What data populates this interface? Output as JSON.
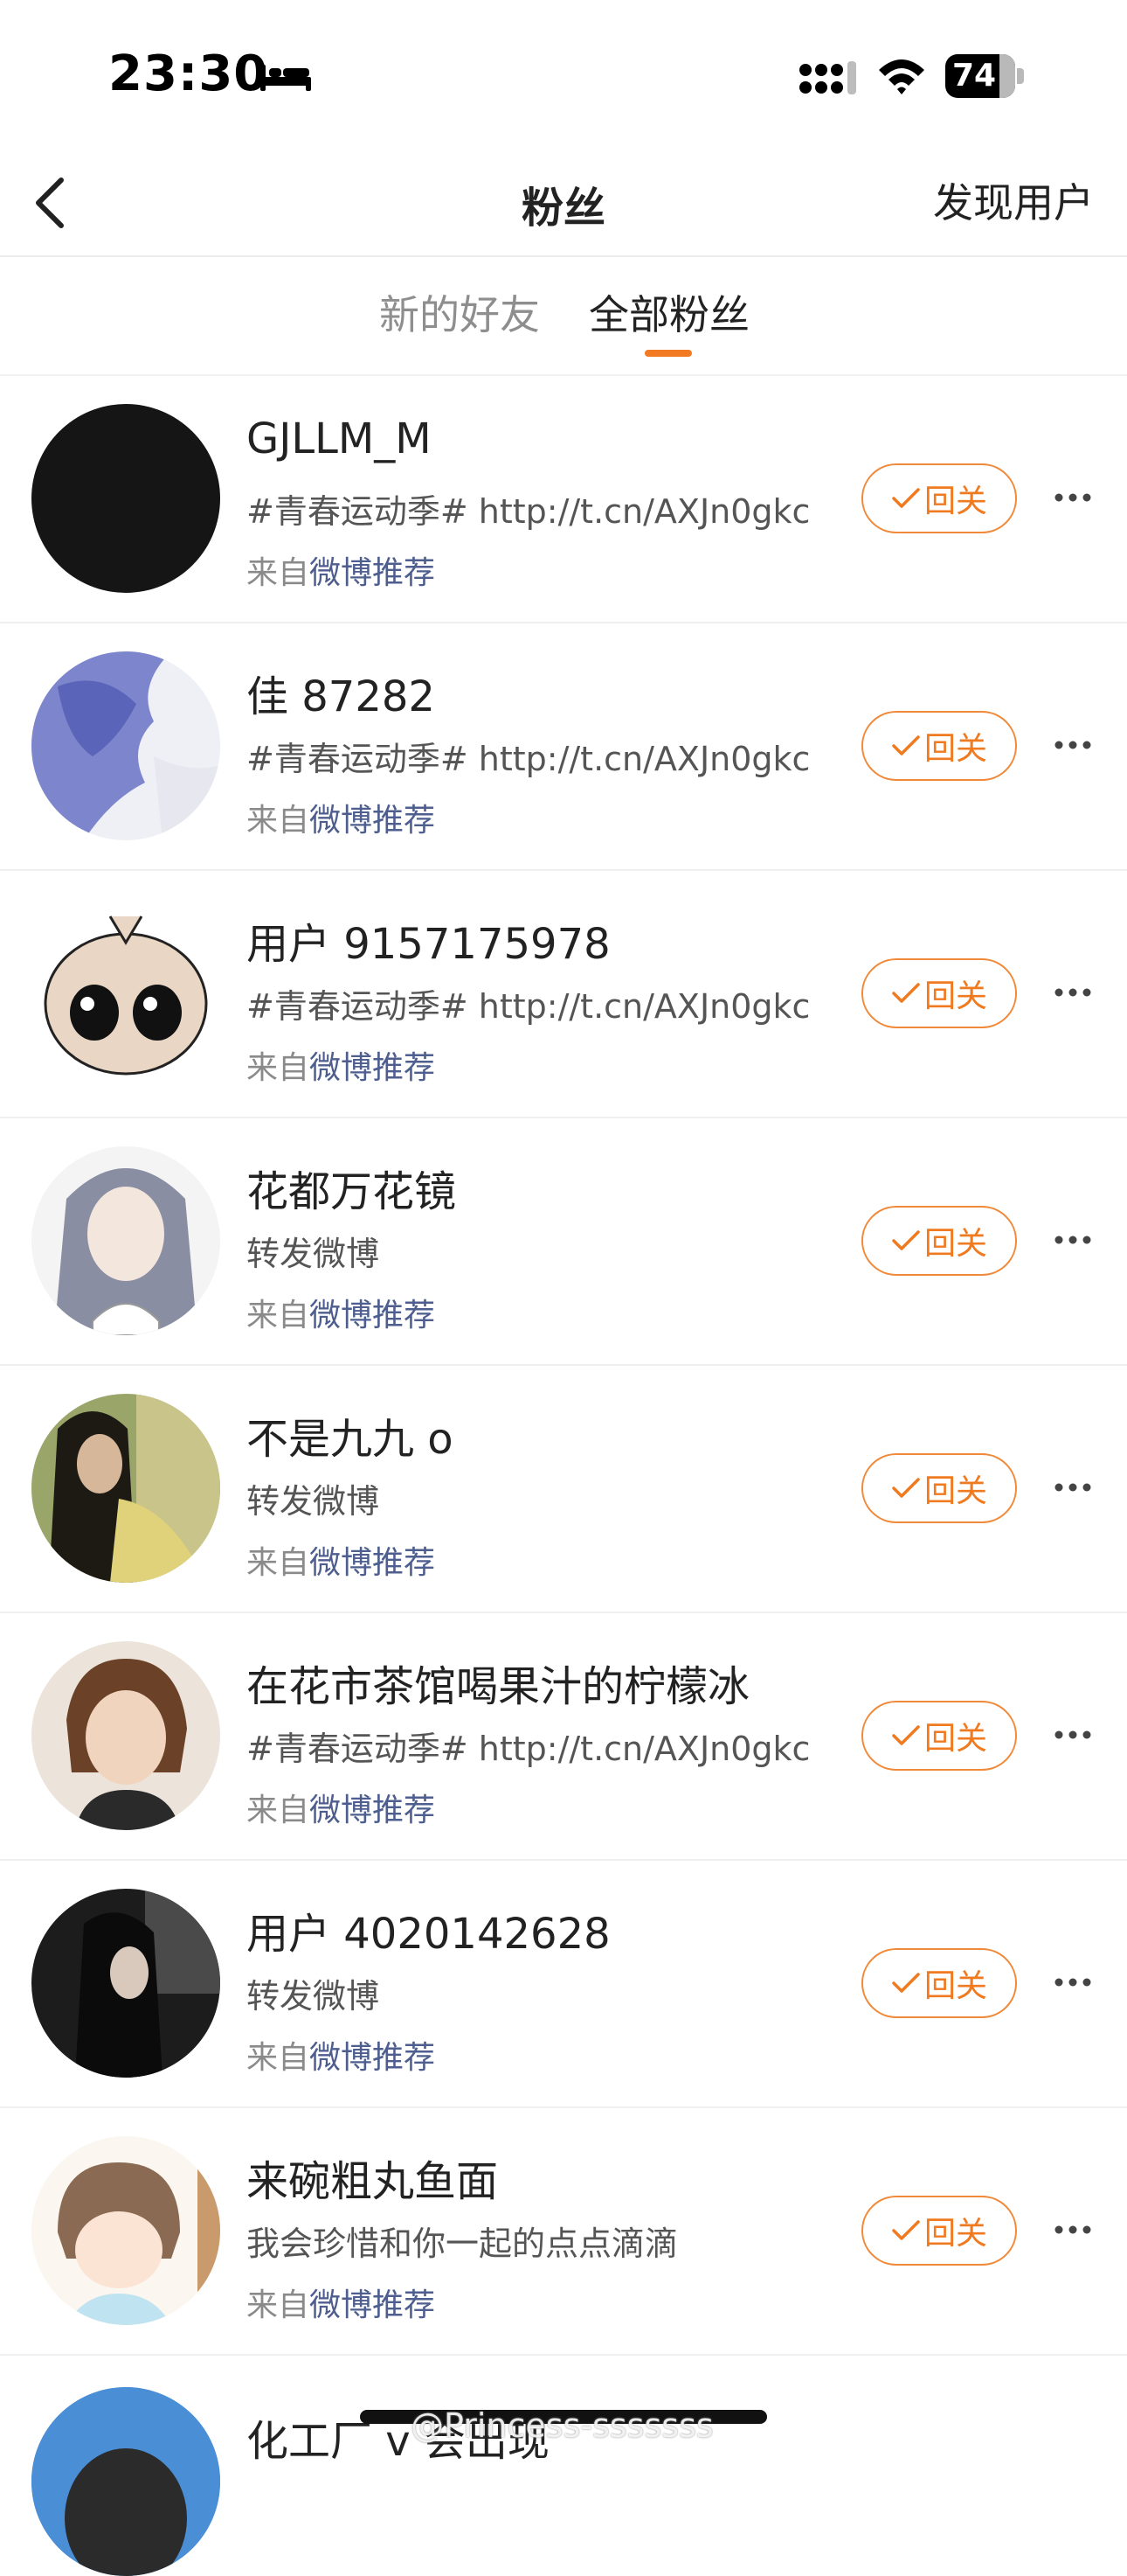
{
  "status_bar": {
    "time": "23:30",
    "battery": "74"
  },
  "nav": {
    "title": "粉丝",
    "discover": "发现用户"
  },
  "tabs": [
    {
      "label": "新的好友"
    },
    {
      "label": "全部粉丝"
    }
  ],
  "rows": [
    {
      "name": "GJLLM_M",
      "desc": "#青春运动季# http://t.cn/AXJn0gkc",
      "source_prefix": "来自",
      "source_link": "微博推荐",
      "button": "回关"
    },
    {
      "name": "佳 87282",
      "desc": "#青春运动季# http://t.cn/AXJn0gkc",
      "source_prefix": "来自",
      "source_link": "微博推荐",
      "button": "回关"
    },
    {
      "name": "用户 9157175978",
      "desc": "#青春运动季# http://t.cn/AXJn0gkc",
      "source_prefix": "来自",
      "source_link": "微博推荐",
      "button": "回关"
    },
    {
      "name": "花都万花镜",
      "desc": "转发微博",
      "source_prefix": "来自",
      "source_link": "微博推荐",
      "button": "回关"
    },
    {
      "name": "不是九九 o",
      "desc": "转发微博",
      "source_prefix": "来自",
      "source_link": "微博推荐",
      "button": "回关"
    },
    {
      "name": "在花市茶馆喝果汁的柠檬冰",
      "desc": "#青春运动季# http://t.cn/AXJn0gkc",
      "source_prefix": "来自",
      "source_link": "微博推荐",
      "button": "回关"
    },
    {
      "name": "用户 4020142628",
      "desc": "转发微博",
      "source_prefix": "来自",
      "source_link": "微博推荐",
      "button": "回关"
    },
    {
      "name": "来碗粗丸鱼面",
      "desc": "我会珍惜和你一起的点点滴滴",
      "source_prefix": "来自",
      "source_link": "微博推荐",
      "button": "回关"
    }
  ],
  "partial_row": {
    "name": "化工厂 v 会出现"
  },
  "watermark": "@Princess-sssssss",
  "colors": {
    "accent": "#f27a22",
    "link": "#4d5e8f"
  }
}
